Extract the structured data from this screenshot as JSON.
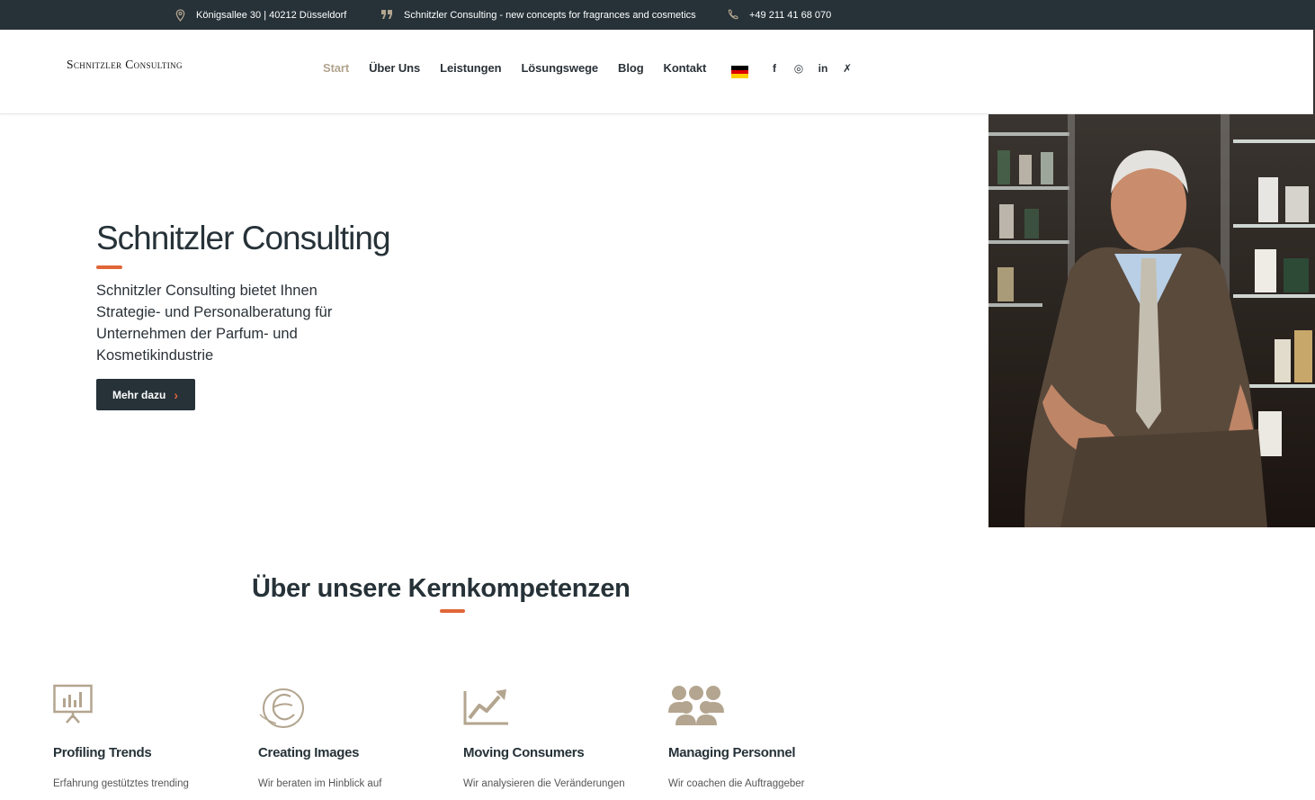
{
  "topbar": {
    "address": "Königsallee 30 | 40212 Düsseldorf",
    "slogan": "Schnitzler Consulting - new concepts for fragrances and cosmetics",
    "phone": "+49 211 41 68 070",
    "icons": [
      "map-pin-icon",
      "quote-icon",
      "phone-icon"
    ]
  },
  "header": {
    "logo": "Schnitzler Consulting",
    "nav": [
      "Start",
      "Über Uns",
      "Leistungen",
      "Lösungswege",
      "Blog",
      "Kontakt"
    ],
    "active_nav": "Start",
    "language_flag": "german-flag-icon",
    "social": [
      {
        "name": "facebook-icon",
        "glyph": "f"
      },
      {
        "name": "instagram-icon",
        "glyph": "◎"
      },
      {
        "name": "linkedin-icon",
        "glyph": "in"
      },
      {
        "name": "xing-icon",
        "glyph": "✗"
      }
    ]
  },
  "hero": {
    "title": "Schnitzler Consulting",
    "text": "Schnitzler Consulting bietet Ihnen Strategie- und Personalberatung für Unternehmen der Parfum- und Kosmetikindustrie",
    "button": "Mehr dazu"
  },
  "section": {
    "title": "Über unsere Kernkompetenzen",
    "cards": [
      {
        "title": "Profiling Trends",
        "text": "Erfahrung gestütztes trending",
        "icon": "presentation-chart-icon"
      },
      {
        "title": "Creating Images",
        "text": "Wir beraten im Hinblick auf",
        "icon": "brand-e-icon"
      },
      {
        "title": "Moving Consumers",
        "text": "Wir analysieren die Veränderungen",
        "icon": "trend-chart-icon"
      },
      {
        "title": "Managing Personnel",
        "text": "Wir coachen die Auftraggeber",
        "icon": "team-icon"
      }
    ]
  },
  "colors": {
    "dark": "#263238",
    "accent": "#e06637",
    "gold": "#b3a58f",
    "active_nav": "#b3a58f"
  }
}
